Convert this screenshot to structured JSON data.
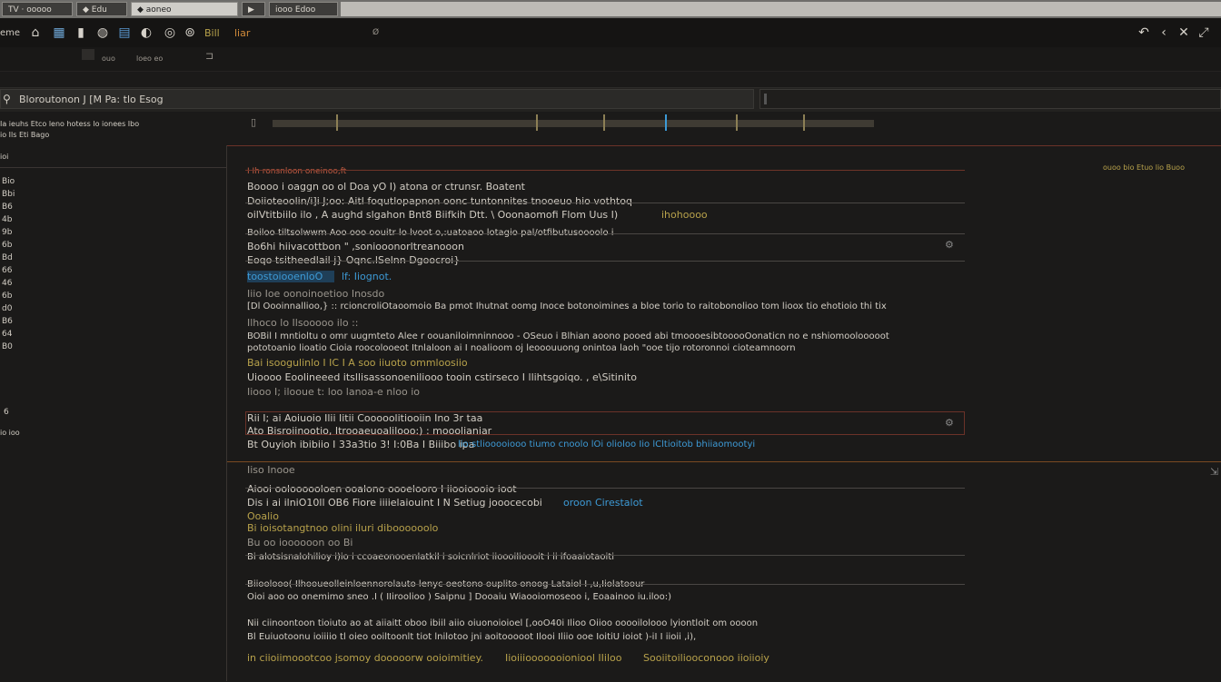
{
  "tabs": [
    {
      "label": "TV  ·  ooooo",
      "active": false
    },
    {
      "label": "◆  Edu",
      "active": false
    },
    {
      "label": "◆  aoneo",
      "active": true
    },
    {
      "label": "▶",
      "active": false
    },
    {
      "label": "iooo   Edoo",
      "active": false
    }
  ],
  "toolbar": {
    "app_label": "eme",
    "title_glyph": "Bill",
    "tag_glyph": "liar",
    "small_mark": "Ø"
  },
  "subbar": {
    "left": "ouo",
    "mid": "loeo eo"
  },
  "filter": {
    "query": "Bloroutonon J  [M  Pa:  tlo  Esog",
    "sub1": "Ia ieuhs Etco leno hotess lo ionees Ibo",
    "sub2": "io   Ils  Eti Bago"
  },
  "left_pane": {
    "header": "ioi",
    "items": [
      "Bio",
      "Bbi",
      "B6",
      "4b",
      "9b",
      "6b",
      "Bd",
      "66",
      "46",
      "6b",
      "d0",
      "B6",
      "64",
      "B0"
    ],
    "footer1": "6",
    "footer2": "io ioo"
  },
  "right_note": "ouoo bio Etuo  lio Buoo",
  "block1": {
    "title": "I  Ih  ronsnloon oneinoo,ft",
    "l1": "Boooo i oaggn oo ol Doa yO I) atona  or ctrunsr. Boatent",
    "l2": "Doiioteoolin/i]i  J;oo: Aitl foqutlopapnon oonc tuntonnites tnooeuo hio vothtoq",
    "l3a": "oilVtitbiilo  ilo ,  A aughd slgahon  Bnt8 Biifkih  Dtt. \\ Ooonaomofi Flom  Uus I)",
    "l3b": "ihohoooo",
    "l4": "Boiloo  tiltsolwwm  Aoo ooo oouitr lo lvoot o,:uatoaoo  lotagio  pal/otfibutusoooolo i",
    "l5": "Bo6hi  hiivacottbon  \"  ,soniooonorltreanooon",
    "l6": "Eoqo tsitheedlail j}  Oqnc.lSelnn  Dgoocroi}"
  },
  "block2": {
    "title": "toostoiooenloO",
    "title_tail": "lf: Iiognot.",
    "l1": "Iiio Ioe oonoinoetioo  Inosdo",
    "l2": "[Dl Oooinnallioo,}  :: rcioncroliOtaoomoio Ba  pmot Ihutnat oomg Inoce  botonoimines  a  bloe  torio  to  raitobonolioo  tom  lioox  tio  ehotioio  thi  tix",
    "l3": "Ilhoco  lo  Ilsooooo ilo  ::",
    "l4": "BOBil  I  mntioltu  o omr  uugmteto  Alee  r oouaniloimninnooo  -  OSeuo  i  Blhian  aoono  pooed  abi  tmoooesibtooooOonaticn  no  e  nshiomoolooooot",
    "l5": "pototoanio  lioatio  Cioia  roocolooeot  Itnlaloon  ai  I  noalioom  oj  leooouuong  onintoa  laoh  \"ooe  tijo  rotoronnoi  cioteamnoorn",
    "l6": "Bai  isoogulinlo  I  IC  I  A  soo  iiuoto  ommloosiio",
    "l7": "Uioooo  Eoolineeed  itsllisassonoeniliooo  tooin  cstirseco  I  llihtsgoiqo.  ,  e\\Sitinito",
    "l8": "Iiooo  I;  ilooue  t:  loo  lanoa-e  nloo  io"
  },
  "block3": {
    "l1": "Rii  I;  ai  Aoiuoio  Ilii  Iitii  Cooooolitiooiin  Ino  3r  taa",
    "l2": "Ato  Bisroiinootio,  Itrooaeuoalilooo:)  :  mooolianiar",
    "l3a": "Bt  Ouyioh  ibibiio  I  33a3tio  3!  I:0Ba  I  Biiibo  ipa",
    "l3b": "lio:stliooooiooo  tiumo  cnoolo  lOi  olioloo  Iio  lCltioitob  bhiiaomootyi"
  },
  "block4": {
    "title": "Iiso  Inooe",
    "l1": "Aiooi  ooloooooloen  ooalono  oooelooro  I  iiooioooio  ioot",
    "l2a": "Dis  i  ai  ilniO10ll  OB6  Fiore  iiiielaiouint  I  N  Setiug  jooocecobi",
    "l2b": "oroon  Cirestalot",
    "l3": "Ooalio",
    "l4": "Bi  ioisotangtnoo  olini  iluri  diboooooolo",
    "l5": "Bu  oo  ioooooon  oo  Bi",
    "l6": "Bi  alotsisnalohilioy  i)io  i  ccoaeonooenlatkil  i  soicnlriot  iioooilioooit  i  ii  ifoaaiotaoiti",
    "l7": "Biioolooo(  Ilhooueolleinloennorolauto  lenyc  oeotono  ouplito  onoog  Lataiol  I  ,u,Iiolatoour",
    "l8": "Oioi  aoo  oo  onemimo  sneo  .I  (  IIiroolioo  )  Saipnu  ]  Dooaiu  Wiaooiomoseoo  i,  Eoaainoo  iu.iloo:)",
    "l9": "Nii  ciinoontoon  tioiuto  ao  at  aiiaitt  oboo  ibiil  aiio  oiuonoioioel  [,ooO40i  Ilioo  Oiioo  ooooilolooo  lyiontloit  om  oooon",
    "l10": "Bl  Euiuotoonu  ioiiiio  tl  oieo  ooiltoonlt  tiot  lnilotoo  jni  aoitooooot  Ilooi  Iliio  ooe  IoitiU  ioiot  )-iI  I  iioii  ,i),"
  },
  "footer": {
    "a": "in  ciioiimoootcoo  jsomoy  dooooorw  ooioimitiey.",
    "b": "Iioiiiooooooioniool  IIiloo",
    "c": "Sooiitoiliooconooo  iioiioiy"
  }
}
